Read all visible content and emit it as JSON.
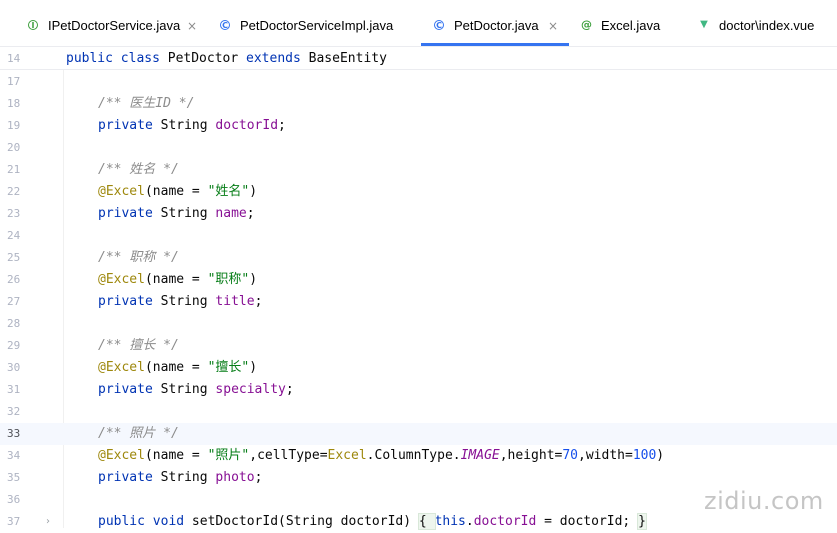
{
  "tabs": [
    {
      "label": "IPetDoctorService.java",
      "icon": "interface-icon",
      "glyph": "I",
      "icon_color": "#3d9f3d",
      "active": false,
      "closable": true
    },
    {
      "label": "PetDoctorServiceImpl.java",
      "icon": "class-icon",
      "glyph": "C",
      "icon_color": "#3574f0",
      "active": false,
      "closable": false
    },
    {
      "label": "PetDoctor.java",
      "icon": "class-icon",
      "glyph": "C",
      "icon_color": "#3574f0",
      "active": true,
      "closable": true
    },
    {
      "label": "Excel.java",
      "icon": "annotation-icon",
      "glyph": "@",
      "icon_color": "#3d9f3d",
      "active": false,
      "closable": false
    },
    {
      "label": "doctor\\index.vue",
      "icon": "vue-icon",
      "glyph": "▼",
      "icon_color": "#41b883",
      "active": false,
      "closable": false
    }
  ],
  "close_glyph": "×",
  "sticky_line": {
    "number": "14",
    "tokens": [
      {
        "t": "public class ",
        "c": "kw"
      },
      {
        "t": "PetDoctor ",
        "c": ""
      },
      {
        "t": "extends ",
        "c": "kw"
      },
      {
        "t": "BaseEntity",
        "c": ""
      }
    ]
  },
  "lines": [
    {
      "number": "17",
      "tokens": []
    },
    {
      "number": "18",
      "tokens": [
        {
          "t": "/** 医生ID */",
          "c": "cm"
        }
      ]
    },
    {
      "number": "19",
      "tokens": [
        {
          "t": "private ",
          "c": "kw"
        },
        {
          "t": "String ",
          "c": ""
        },
        {
          "t": "doctorId",
          "c": "fld"
        },
        {
          "t": ";",
          "c": ""
        }
      ]
    },
    {
      "number": "20",
      "tokens": []
    },
    {
      "number": "21",
      "tokens": [
        {
          "t": "/** 姓名 */",
          "c": "cm"
        }
      ]
    },
    {
      "number": "22",
      "tokens": [
        {
          "t": "@Excel",
          "c": "an"
        },
        {
          "t": "(name = ",
          "c": ""
        },
        {
          "t": "\"姓名\"",
          "c": "str"
        },
        {
          "t": ")",
          "c": ""
        }
      ]
    },
    {
      "number": "23",
      "tokens": [
        {
          "t": "private ",
          "c": "kw"
        },
        {
          "t": "String ",
          "c": ""
        },
        {
          "t": "name",
          "c": "fld"
        },
        {
          "t": ";",
          "c": ""
        }
      ]
    },
    {
      "number": "24",
      "tokens": []
    },
    {
      "number": "25",
      "tokens": [
        {
          "t": "/** 职称 */",
          "c": "cm"
        }
      ]
    },
    {
      "number": "26",
      "tokens": [
        {
          "t": "@Excel",
          "c": "an"
        },
        {
          "t": "(name = ",
          "c": ""
        },
        {
          "t": "\"职称\"",
          "c": "str"
        },
        {
          "t": ")",
          "c": ""
        }
      ]
    },
    {
      "number": "27",
      "tokens": [
        {
          "t": "private ",
          "c": "kw"
        },
        {
          "t": "String ",
          "c": ""
        },
        {
          "t": "title",
          "c": "fld"
        },
        {
          "t": ";",
          "c": ""
        }
      ]
    },
    {
      "number": "28",
      "tokens": []
    },
    {
      "number": "29",
      "tokens": [
        {
          "t": "/** 擅长 */",
          "c": "cm"
        }
      ]
    },
    {
      "number": "30",
      "tokens": [
        {
          "t": "@Excel",
          "c": "an"
        },
        {
          "t": "(name = ",
          "c": ""
        },
        {
          "t": "\"擅长\"",
          "c": "str"
        },
        {
          "t": ")",
          "c": ""
        }
      ]
    },
    {
      "number": "31",
      "tokens": [
        {
          "t": "private ",
          "c": "kw"
        },
        {
          "t": "String ",
          "c": ""
        },
        {
          "t": "specialty",
          "c": "fld"
        },
        {
          "t": ";",
          "c": ""
        }
      ]
    },
    {
      "number": "32",
      "tokens": []
    },
    {
      "number": "33",
      "current": true,
      "tokens": [
        {
          "t": "/** 照片 */",
          "c": "cm"
        }
      ]
    },
    {
      "number": "34",
      "tokens": [
        {
          "t": "@Excel",
          "c": "an"
        },
        {
          "t": "(name = ",
          "c": ""
        },
        {
          "t": "\"照片\"",
          "c": "str"
        },
        {
          "t": ",cellType=",
          "c": ""
        },
        {
          "t": "Excel",
          "c": "an"
        },
        {
          "t": ".ColumnType.",
          "c": ""
        },
        {
          "t": "IMAGE",
          "c": "const"
        },
        {
          "t": ",height=",
          "c": ""
        },
        {
          "t": "70",
          "c": "num"
        },
        {
          "t": ",width=",
          "c": ""
        },
        {
          "t": "100",
          "c": "num"
        },
        {
          "t": ")",
          "c": ""
        }
      ]
    },
    {
      "number": "35",
      "tokens": [
        {
          "t": "private ",
          "c": "kw"
        },
        {
          "t": "String ",
          "c": ""
        },
        {
          "t": "photo",
          "c": "fld"
        },
        {
          "t": ";",
          "c": ""
        }
      ]
    },
    {
      "number": "36",
      "tokens": []
    },
    {
      "number": "37",
      "fold": true,
      "tokens": [
        {
          "t": "public void ",
          "c": "kw"
        },
        {
          "t": "setDoctorId(String doctorId) ",
          "c": ""
        },
        {
          "t": "{ ",
          "c": "fold-box"
        },
        {
          "t": "this",
          "c": "kw"
        },
        {
          "t": ".",
          "c": ""
        },
        {
          "t": "doctorId",
          "c": "fld"
        },
        {
          "t": " = doctorId; ",
          "c": ""
        },
        {
          "t": "}",
          "c": "fold-box"
        }
      ]
    }
  ],
  "fold_glyph": "›",
  "watermark": "zidiu.com"
}
